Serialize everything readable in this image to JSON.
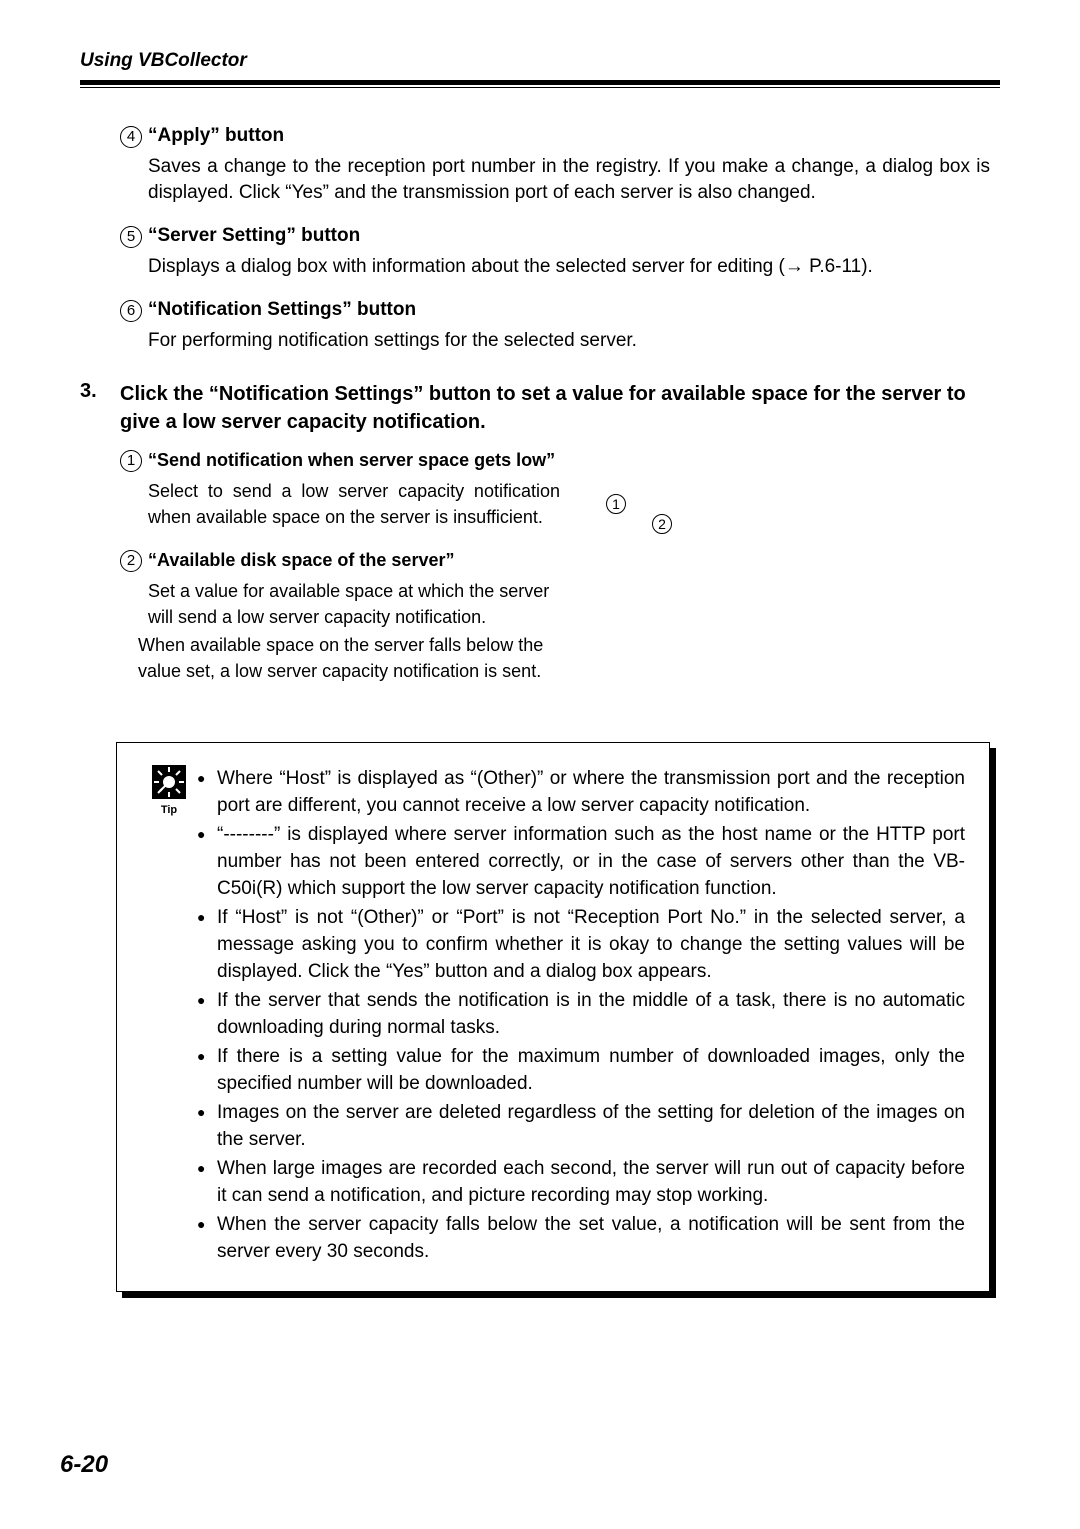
{
  "header": "Using VBCollector",
  "sections": {
    "four": {
      "num": "4",
      "title": "“Apply” button",
      "body": "Saves a change to the reception port number in the registry. If you make a change, a dialog box is displayed. Click “Yes” and the transmission port of each server is also changed."
    },
    "five": {
      "num": "5",
      "title": "“Server Setting” button",
      "body": "Displays a dialog box with information about the selected server for editing (→ P.6-11)."
    },
    "six": {
      "num": "6",
      "title": "“Notification Settings” button",
      "body": "For performing notification settings for the selected server."
    }
  },
  "step": {
    "num": "3.",
    "title": "Click the “Notification Settings” button to set a value for available space for the server to give a low server capacity notification."
  },
  "sub": {
    "one": {
      "num": "1",
      "title": "“Send notification when server space gets low”",
      "body": "Select to send a low server capacity notification when available space on the server is insufficient."
    },
    "two": {
      "num": "2",
      "title": "“Available disk space of the server”",
      "body1": "Set a value for available space at which the server will send a low server capacity notification.",
      "body2": "When available space on the server falls below the value set, a low server capacity notification is sent."
    }
  },
  "callouts": {
    "c1": "1",
    "c2": "2"
  },
  "tip_label": "Tip",
  "tips": {
    "t0": "Where “Host” is displayed as “(Other)” or where the transmission port and the reception port are different, you cannot receive a low server capacity notification.",
    "t1": "“--------” is displayed where server information such as the host name or the HTTP port number has not been entered correctly, or in the case of servers other than the VB-C50i(R) which support the low server capacity notification function.",
    "t2": "If “Host” is not “(Other)” or “Port” is not “Reception Port No.” in the selected server, a message asking you to confirm whether it is okay to change the setting values will be displayed. Click the “Yes” button and a dialog box appears.",
    "t3": "If the server that sends the notification is in the middle of a task, there is no automatic downloading during normal tasks.",
    "t4": "If there is a setting value for the maximum number of downloaded images, only the specified number will be downloaded.",
    "t5": "Images on the server are deleted regardless of the setting for deletion of the images on the server.",
    "t6": "When large images are recorded each second, the server will run out of capacity before it can send a notification, and picture recording may stop working.",
    "t7": "When the server capacity falls below the set value, a notification will be sent from the server every 30 seconds."
  },
  "page_number": "6-20"
}
